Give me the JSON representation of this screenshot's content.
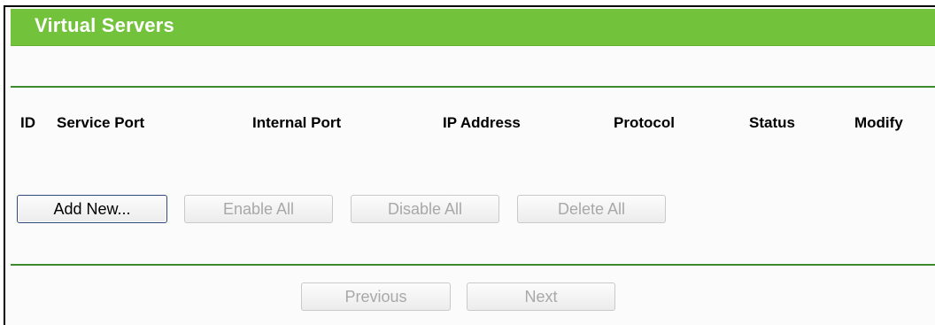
{
  "section": {
    "title": "Virtual Servers"
  },
  "table": {
    "columns": [
      "ID",
      "Service Port",
      "Internal Port",
      "IP Address",
      "Protocol",
      "Status",
      "Modify"
    ],
    "rows": []
  },
  "actions": {
    "add_new": "Add New...",
    "enable_all": "Enable All",
    "disable_all": "Disable All",
    "delete_all": "Delete All"
  },
  "pagination": {
    "previous": "Previous",
    "next": "Next"
  },
  "colors": {
    "title_bar": "#73c23b",
    "rule": "#3b8a2c",
    "disabled_text": "#a8a8a8"
  }
}
